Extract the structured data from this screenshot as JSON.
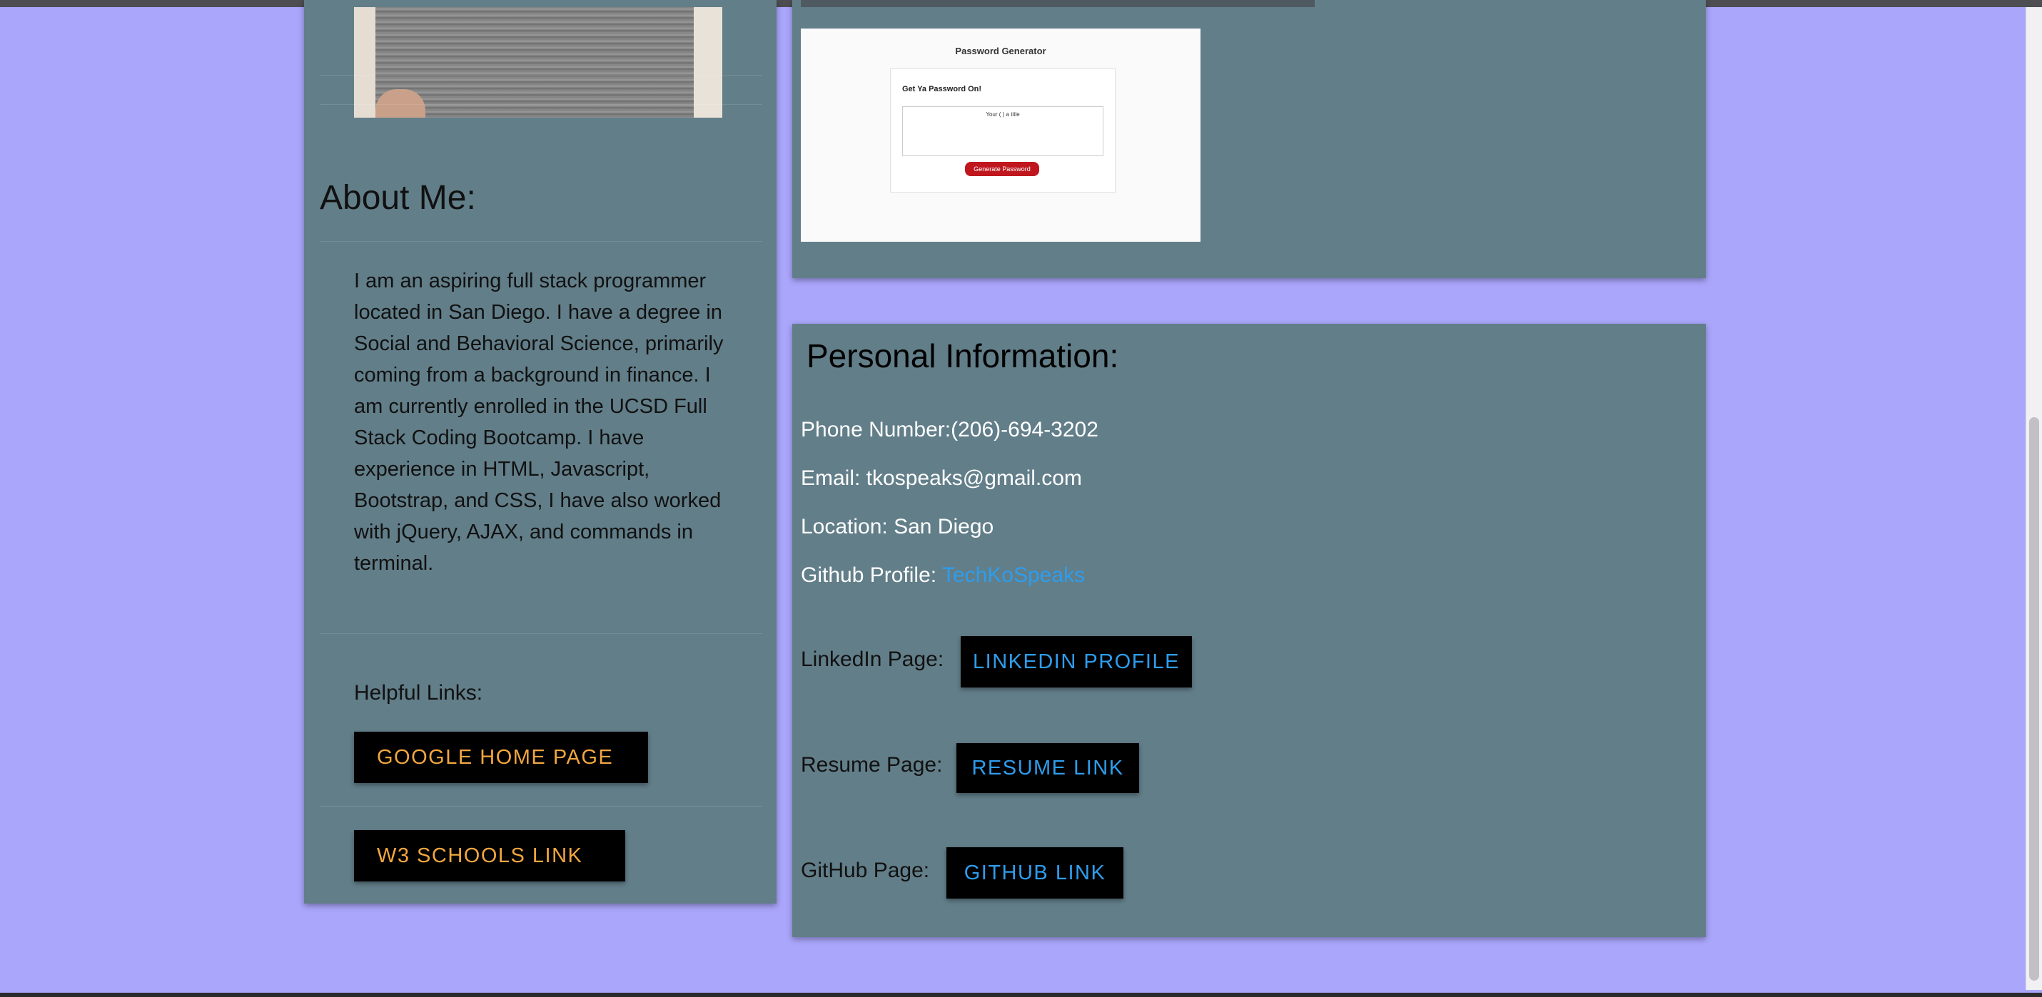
{
  "about": {
    "title": "About Me:",
    "text": "I am an aspiring full stack programmer located in San Diego. I have a degree in Social and Behavioral Science, primarily coming from a background in finance. I am currently enrolled in the UCSD Full Stack Coding Bootcamp. I have experience in HTML, Javascript, Bootstrap, and CSS, I have also worked with jQuery, AJAX, and commands in terminal."
  },
  "links": {
    "label": "Helpful Links:",
    "google": "GOOGLE HOME PAGE",
    "w3": "W3 SCHOOLS LINK"
  },
  "project": {
    "screenshot_title": "Password Generator",
    "screenshot_subtitle": "Get Ya Password On!",
    "screenshot_placeholder": "Your ( ) a title",
    "screenshot_button": "Generate Password"
  },
  "info": {
    "title": "Personal Information:",
    "phone": "Phone Number:(206)-694-3202",
    "email": "Email: tkospeaks@gmail.com",
    "location": "Location: San Diego",
    "github_prefix": "Github Profile: ",
    "github_username": "TechKoSpeaks",
    "linkedin_label": "LinkedIn Page:",
    "linkedin_button": "LINKEDIN PROFILE",
    "resume_label": "Resume Page:",
    "resume_button": "RESUME LINK",
    "github_label": "GitHub Page:",
    "github_button": "GITHUB LINK"
  },
  "colors": {
    "page_background": "#aaa6fb",
    "panel": "#627e89",
    "button_bg": "#000000",
    "orange_link": "#f2a640",
    "blue_link": "#2e9ded"
  }
}
